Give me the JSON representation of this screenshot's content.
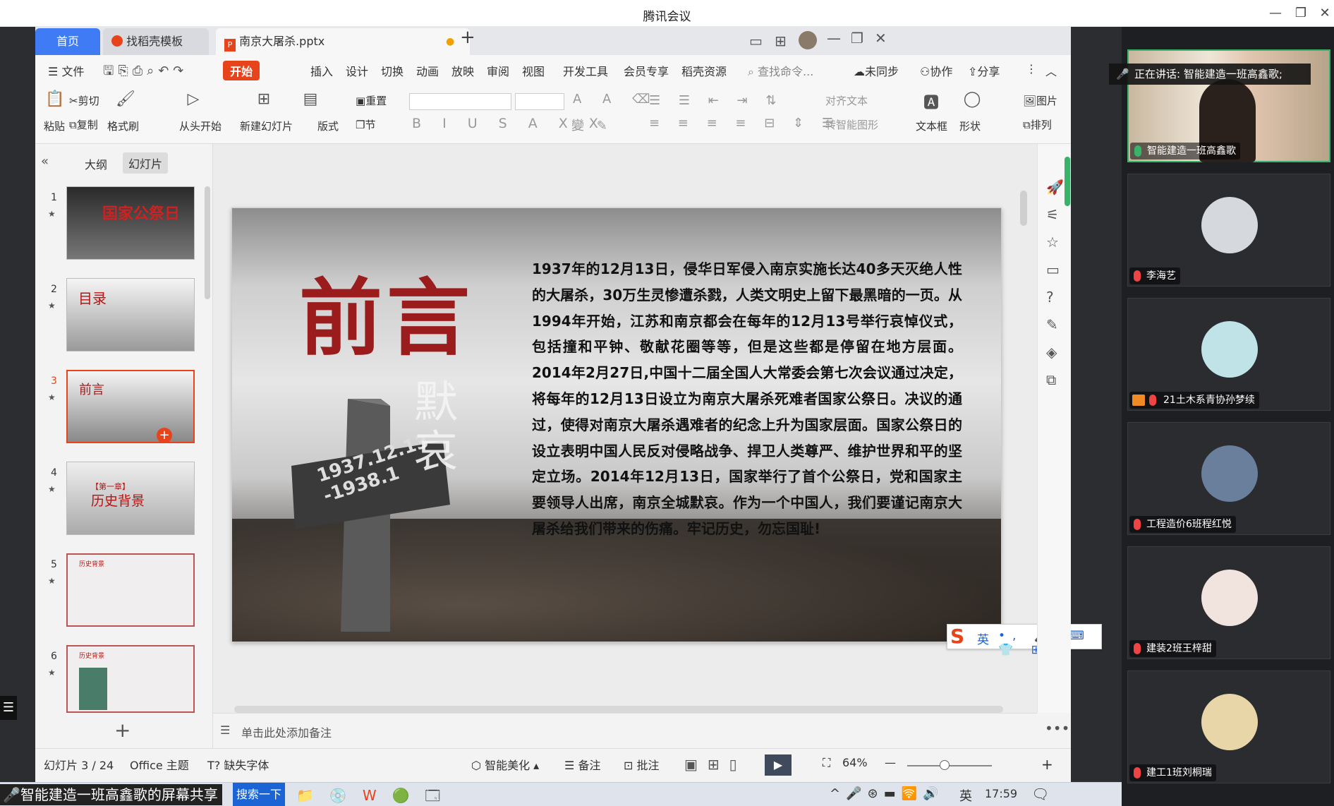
{
  "window": {
    "title": "腾讯会议"
  },
  "tabs": [
    {
      "label": "首页"
    },
    {
      "label": "找稻壳模板"
    },
    {
      "label": "南京大屠杀.pptx"
    }
  ],
  "ribbon_tabs": [
    "文件",
    "开始",
    "插入",
    "设计",
    "切换",
    "动画",
    "放映",
    "审阅",
    "视图",
    "开发工具",
    "会员专享",
    "稻壳资源"
  ],
  "search": {
    "placeholder": "查找命令..."
  },
  "sync": {
    "unsynced": "未同步",
    "collab": "协作",
    "share": "分享"
  },
  "ribbon": {
    "paste": "粘贴",
    "cut": "剪切",
    "copy": "复制",
    "format_painter": "格式刷",
    "from_start": "从头开始",
    "new_slide": "新建幻灯片",
    "layout": "版式",
    "reset": "重置",
    "section": "节",
    "align_text": "对齐文本",
    "smart_shape": "转智能图形",
    "textbox": "文本框",
    "shape": "形状",
    "picture": "图片",
    "arrange": "排列"
  },
  "panel_tabs": {
    "outline": "大纲",
    "slides": "幻灯片"
  },
  "thumbnails": [
    {
      "num": "1",
      "title": "国家公祭日"
    },
    {
      "num": "2",
      "title": "目录"
    },
    {
      "num": "3",
      "title": "前言"
    },
    {
      "num": "4",
      "title": "历史背景",
      "subtitle": "【第一章】"
    },
    {
      "num": "5",
      "title": "历史背景"
    },
    {
      "num": "6",
      "title": "历史背景"
    }
  ],
  "slide": {
    "heading": "前言",
    "cross_text": "1937.12.13 -1938.1",
    "side_text": "默哀",
    "body": "1937年的12月13日，侵华日军侵入南京实施长达40多天灭绝人性的大屠杀，30万生灵惨遭杀戮，人类文明史上留下最黑暗的一页。从1994年开始，江苏和南京都会在每年的12月13号举行哀悼仪式，包括撞和平钟、敬献花圈等等，但是这些都是停留在地方层面。2014年2月27日,中国十二届全国人大常委会第七次会议通过决定，将每年的12月13日设立为南京大屠杀死难者国家公祭日。决议的通过，使得对南京大屠杀遇难者的纪念上升为国家层面。国家公祭日的设立表明中国人民反对侵略战争、捍卫人类尊严、维护世界和平的坚定立场。2014年12月13日，国家举行了首个公祭日，党和国家主要领导人出席，南京全城默哀。作为一个中国人，我们要谨记南京大屠杀给我们带来的伤痛。牢记历史，勿忘国耻!"
  },
  "notes": {
    "placeholder": "单击此处添加备注"
  },
  "statusbar": {
    "slide_count": "幻灯片 3 / 24",
    "theme": "Office 主题",
    "missing_font": "缺失字体",
    "smart_beautify": "智能美化",
    "notes": "备注",
    "comments": "批注",
    "zoom": "64%"
  },
  "ime": {
    "lang": "英"
  },
  "taskbar": {
    "share_label": "智能建造一班高鑫歌的屏幕共享",
    "search": "搜索一下",
    "ime": "英",
    "time": "17:59"
  },
  "meeting": {
    "speaking": "正在讲话: 智能建造一班高鑫歌;",
    "participants": [
      {
        "name": "智能建造一班高鑫歌",
        "avatar_color": "#9a8f83"
      },
      {
        "name": "李海艺",
        "avatar_color": "#d5d8dc"
      },
      {
        "name": "21土木系青协孙梦续",
        "avatar_color": "#bfe3e6"
      },
      {
        "name": "工程造价6班程红悦",
        "avatar_color": "#6a7f9c"
      },
      {
        "name": "建装2班王梓甜",
        "avatar_color": "#f1e4df"
      },
      {
        "name": "建工1班刘桐瑞",
        "avatar_color": "#e8d6a8"
      }
    ]
  },
  "colors": {
    "accent": "#e8441c",
    "brand_blue": "#3e7bf4",
    "slide_red": "#9b1c1c"
  }
}
